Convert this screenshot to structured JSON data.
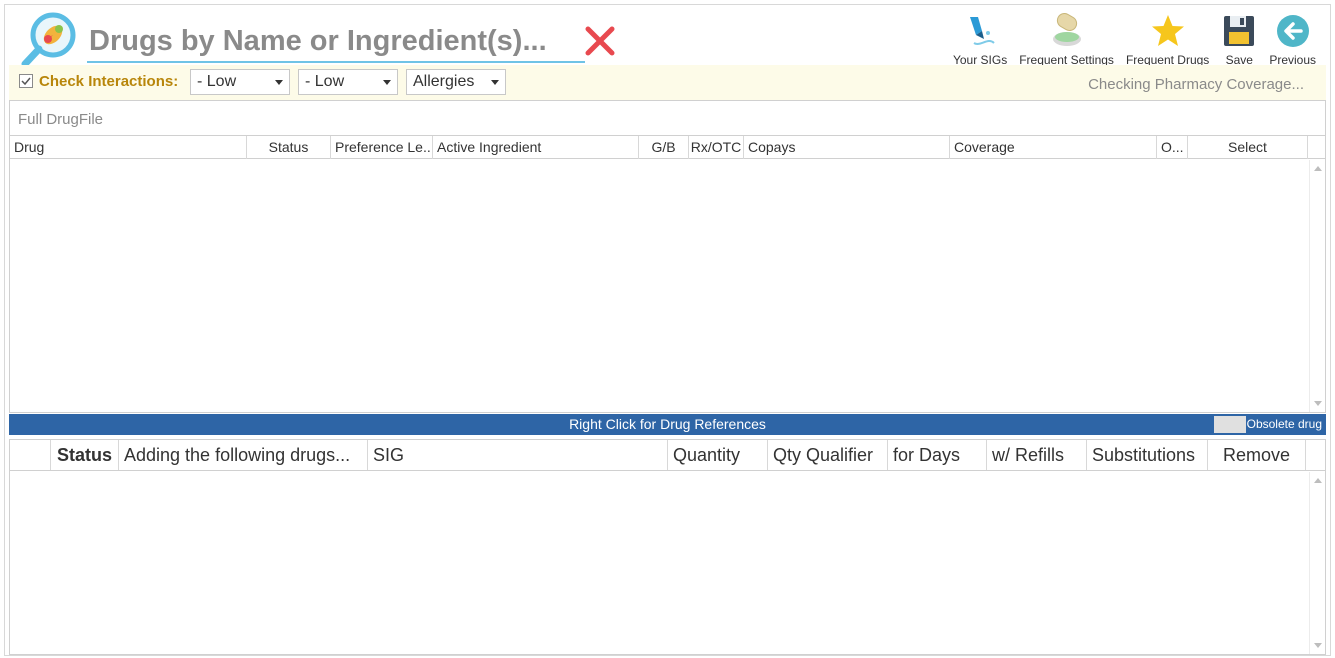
{
  "search": {
    "placeholder": "Drugs by Name or Ingredient(s)...",
    "value": ""
  },
  "toolbar": {
    "items": [
      {
        "label": "Your SIGs",
        "icon": "sig-pen-icon"
      },
      {
        "label": "Frequent Settings",
        "icon": "pill-settings-icon"
      },
      {
        "label": "Frequent Drugs",
        "icon": "star-icon"
      },
      {
        "label": "Save",
        "icon": "floppy-disk-icon"
      },
      {
        "label": "Previous",
        "icon": "back-arrow-icon"
      }
    ]
  },
  "interactions": {
    "checked": true,
    "label": "Check Interactions:",
    "severity1": "- Low",
    "severity2": "- Low",
    "allergies": "Allergies",
    "coverage_status": "Checking Pharmacy Coverage..."
  },
  "drug_file": {
    "title": "Full DrugFile",
    "columns": [
      "Drug",
      "Status",
      "Preference Le...",
      "Active Ingredient",
      "G/B",
      "Rx/OTC",
      "Copays",
      "Coverage",
      "O...",
      "Select"
    ],
    "rows": []
  },
  "info_bar": {
    "message": "Right Click for Drug References",
    "legend_label": "Obsolete drug",
    "legend_color": "#e0e0e0",
    "bar_color": "#2e65a6"
  },
  "adding": {
    "columns": [
      "",
      "Status",
      "Adding the following drugs...",
      "SIG",
      "Quantity",
      "Qty Qualifier",
      "for Days",
      "w/ Refills",
      "Substitutions",
      "Remove"
    ],
    "rows": []
  },
  "colors": {
    "accent": "#6fc3e6",
    "interaction_label": "#b8860b",
    "clear_x": "#e8494f"
  }
}
